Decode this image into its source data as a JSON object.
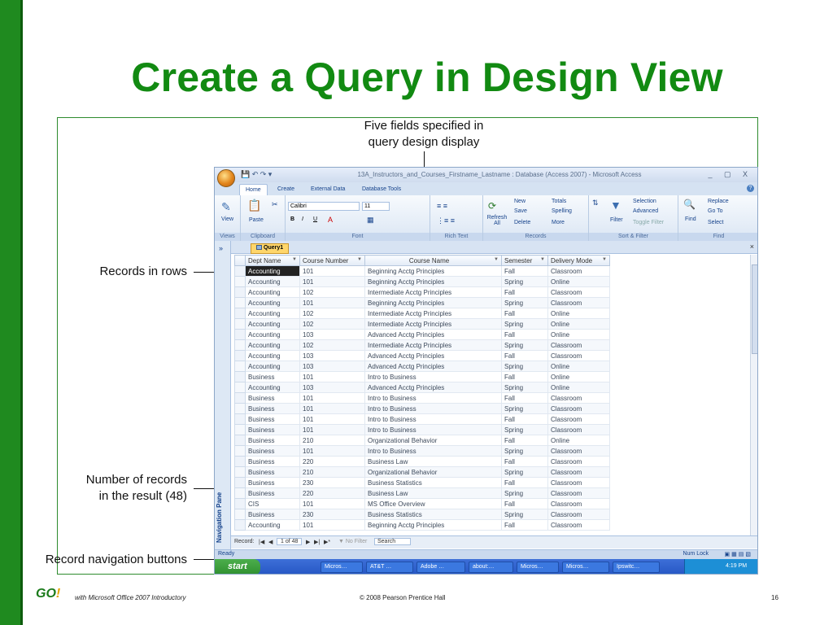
{
  "slide": {
    "title": "Create a Query in Design View",
    "brand": "GO!",
    "footer_left": "with Microsoft Office 2007 Introductory",
    "footer_center": "© 2008 Pearson Prentice Hall",
    "page_number": "16"
  },
  "callouts": {
    "fields": "Five fields specified in\nquery design display",
    "rows": "Records in rows",
    "count": "Number of records\nin the result (48)",
    "nav": "Record navigation buttons"
  },
  "window": {
    "title": "13A_Instructors_and_Courses_Firstname_Lastname : Database (Access 2007) - Microsoft Access",
    "tabs": [
      "Home",
      "Create",
      "External Data",
      "Database Tools"
    ],
    "active_tab": "Home",
    "groups": {
      "views": {
        "label": "Views",
        "view_button": "View"
      },
      "clipboard": {
        "label": "Clipboard",
        "paste_button": "Paste"
      },
      "font": {
        "label": "Font",
        "font_name": "Calibri",
        "font_size": "11",
        "bold": "B",
        "italic": "I",
        "underline": "U"
      },
      "rich_text": {
        "label": "Rich Text"
      },
      "records": {
        "label": "Records",
        "refresh": "Refresh All",
        "new": "New",
        "save": "Save",
        "delete": "Delete",
        "totals": "Totals",
        "spelling": "Spelling",
        "more": "More"
      },
      "sort_filter": {
        "label": "Sort & Filter",
        "filter": "Filter",
        "selection": "Selection",
        "advanced": "Advanced",
        "toggle_filter": "Toggle Filter"
      },
      "find": {
        "label": "Find",
        "find": "Find",
        "replace": "Replace",
        "goto": "Go To",
        "select": "Select"
      }
    },
    "nav_pane": {
      "label": "Navigation Pane"
    },
    "query_tab": "Query1",
    "columns": [
      "Dept Name",
      "Course Number",
      "Course Name",
      "Semester",
      "Delivery Mode"
    ],
    "rows": [
      [
        "Accounting",
        "101",
        "Beginning Acctg Principles",
        "Fall",
        "Classroom"
      ],
      [
        "Accounting",
        "101",
        "Beginning Acctg Principles",
        "Spring",
        "Online"
      ],
      [
        "Accounting",
        "102",
        "Intermediate Acctg Principles",
        "Fall",
        "Classroom"
      ],
      [
        "Accounting",
        "101",
        "Beginning Acctg Principles",
        "Spring",
        "Classroom"
      ],
      [
        "Accounting",
        "102",
        "Intermediate Acctg Principles",
        "Fall",
        "Online"
      ],
      [
        "Accounting",
        "102",
        "Intermediate Acctg Principles",
        "Spring",
        "Online"
      ],
      [
        "Accounting",
        "103",
        "Advanced Acctg Principles",
        "Fall",
        "Online"
      ],
      [
        "Accounting",
        "102",
        "Intermediate Acctg Principles",
        "Spring",
        "Classroom"
      ],
      [
        "Accounting",
        "103",
        "Advanced Acctg Principles",
        "Fall",
        "Classroom"
      ],
      [
        "Accounting",
        "103",
        "Advanced Acctg Principles",
        "Spring",
        "Online"
      ],
      [
        "Business",
        "101",
        "Intro to Business",
        "Fall",
        "Online"
      ],
      [
        "Accounting",
        "103",
        "Advanced Acctg Principles",
        "Spring",
        "Online"
      ],
      [
        "Business",
        "101",
        "Intro to Business",
        "Fall",
        "Classroom"
      ],
      [
        "Business",
        "101",
        "Intro to Business",
        "Spring",
        "Classroom"
      ],
      [
        "Business",
        "101",
        "Intro to Business",
        "Fall",
        "Classroom"
      ],
      [
        "Business",
        "101",
        "Intro to Business",
        "Spring",
        "Classroom"
      ],
      [
        "Business",
        "210",
        "Organizational Behavior",
        "Fall",
        "Online"
      ],
      [
        "Business",
        "101",
        "Intro to Business",
        "Spring",
        "Classroom"
      ],
      [
        "Business",
        "220",
        "Business Law",
        "Fall",
        "Classroom"
      ],
      [
        "Business",
        "210",
        "Organizational Behavior",
        "Spring",
        "Classroom"
      ],
      [
        "Business",
        "230",
        "Business Statistics",
        "Fall",
        "Classroom"
      ],
      [
        "Business",
        "220",
        "Business Law",
        "Spring",
        "Classroom"
      ],
      [
        "CIS",
        "101",
        "MS Office Overview",
        "Fall",
        "Classroom"
      ],
      [
        "Business",
        "230",
        "Business Statistics",
        "Spring",
        "Classroom"
      ],
      [
        "Accounting",
        "101",
        "Beginning Acctg Principles",
        "Fall",
        "Classroom"
      ]
    ],
    "record_nav": {
      "label": "Record:",
      "position": "1 of 48",
      "no_filter": "No Filter",
      "search": "Search"
    },
    "status": {
      "left": "Ready",
      "right": "Num Lock"
    },
    "taskbar": {
      "start": "start",
      "items": [
        "Micros…",
        "AT&T …",
        "Adobe …",
        "about:…",
        "Micros…",
        "Micros…",
        "Ipswitc…"
      ],
      "clock": "4:19 PM"
    }
  }
}
